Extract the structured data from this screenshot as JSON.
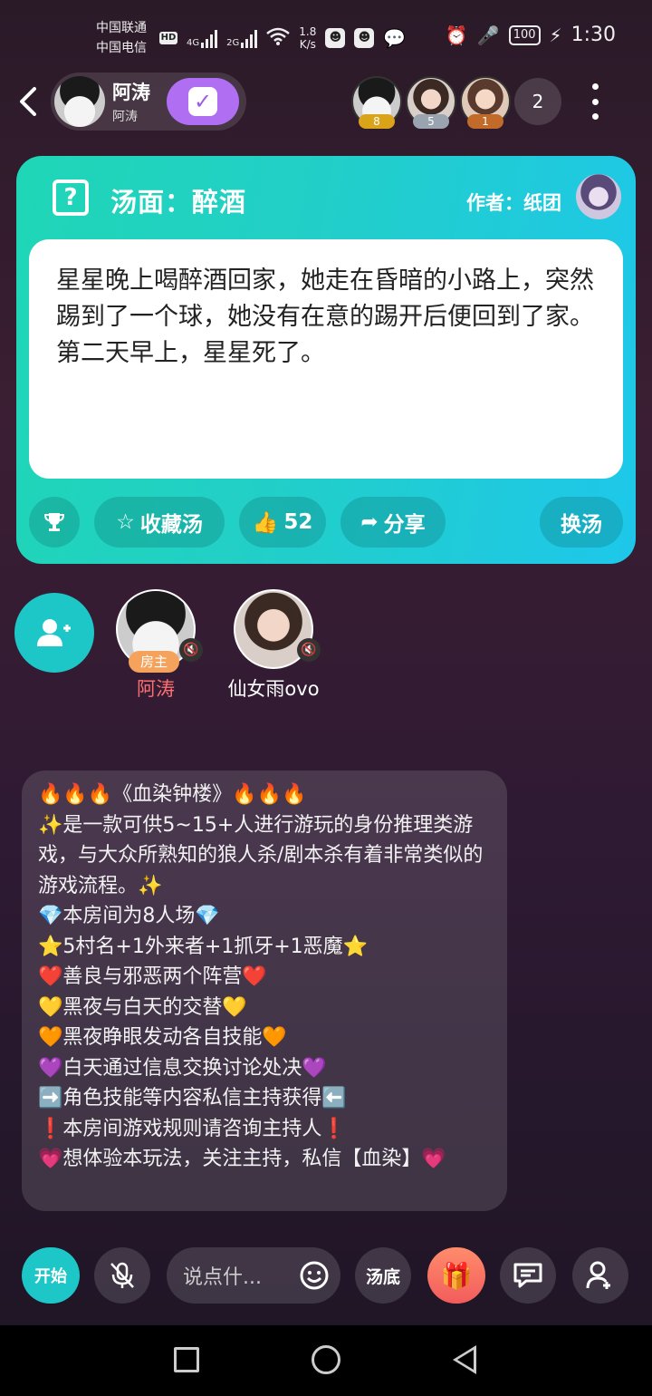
{
  "status_bar": {
    "carrier_1": "中国联通",
    "carrier_2": "中国电信",
    "hd": "HD",
    "net_4g": "4G",
    "net_2g": "2G",
    "speed_value": "1.8",
    "speed_unit": "K/s",
    "battery": "100",
    "time": "1:30"
  },
  "header": {
    "back_icon": "back-arrow-icon",
    "host_name": "阿涛",
    "host_sub": "阿涛",
    "follow_icon": "check-calendar-icon",
    "audience": [
      {
        "rank": "8",
        "rank_color": "#d9a31a"
      },
      {
        "rank": "5",
        "rank_color": "#9aa3b0"
      },
      {
        "rank": "1",
        "rank_color": "#c26a2a"
      }
    ],
    "audience_count": "2"
  },
  "card": {
    "title": "汤面：醉酒",
    "author": "作者：纸团",
    "story": "星星晚上喝醉酒回家，她走在昏暗的小路上，突然踢到了一个球，她没有在意的踢开后便回到了家。第二天早上，星星死了。",
    "buttons": {
      "favorite": "收藏汤",
      "likes": "52",
      "share": "分享",
      "change": "换汤"
    },
    "accent_from": "#1fd6b6",
    "accent_to": "#1ec7ea"
  },
  "seats": [
    {
      "name": "阿涛",
      "tag": "房主",
      "name_color": "#ff6f6f"
    },
    {
      "name": "仙女雨ovo",
      "name_color": "#ffffff"
    }
  ],
  "notice": {
    "lines": [
      "🔥🔥🔥《血染钟楼》🔥🔥🔥",
      "✨是一款可供5~15+人进行游玩的身份推理类游戏，与大众所熟知的狼人杀/剧本杀有着非常类似的游戏流程。✨",
      "💎本房间为8人场💎",
      "⭐5村名+1外来者+1抓牙+1恶魔⭐",
      "❤️善良与邪恶两个阵营❤️",
      "💛黑夜与白天的交替💛",
      "🧡黑夜睁眼发动各自技能🧡",
      "💜白天通过信息交换讨论处决💜",
      "➡️角色技能等内容私信主持获得⬅️",
      "❗本房间游戏规则请咨询主持人❗",
      "💗想体验本玩法，关注主持，私信【血染】💗"
    ]
  },
  "toolbar": {
    "start": "开始",
    "chat_placeholder": "说点什...",
    "soup_bottom": "汤底"
  }
}
